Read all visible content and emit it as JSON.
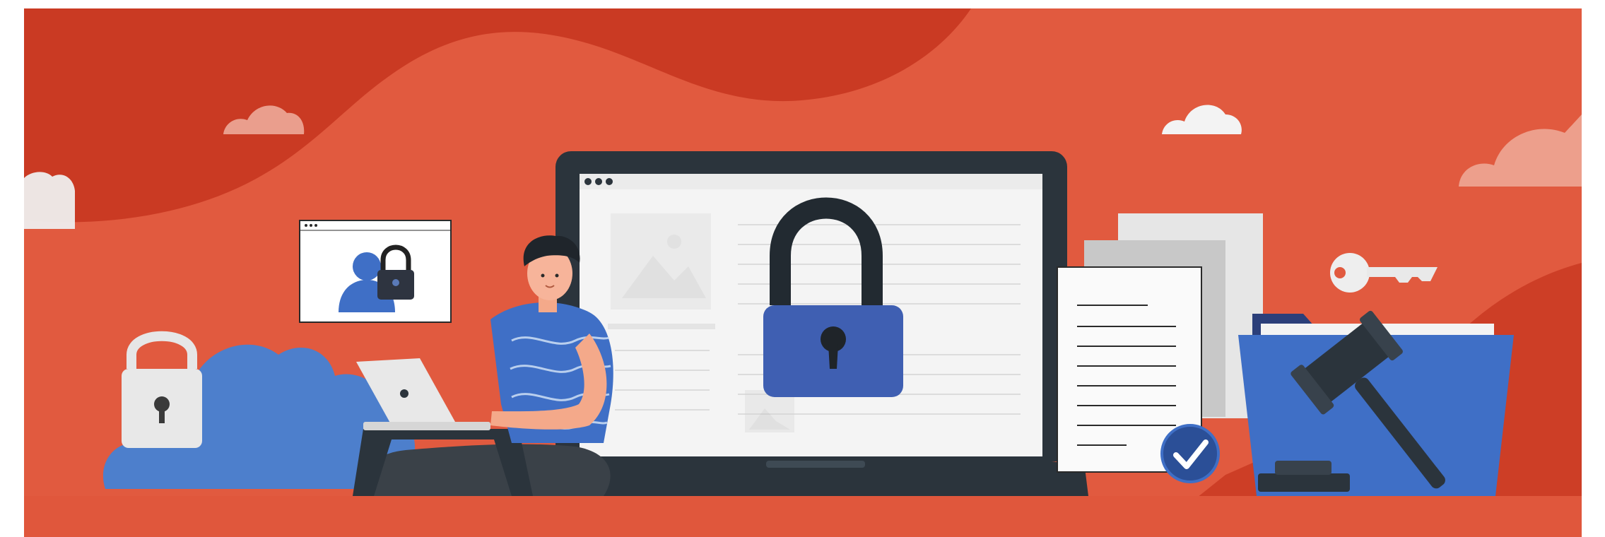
{
  "scene": {
    "name": "data-privacy-security-illustration",
    "elements": [
      "cloud-icon",
      "lock-icon",
      "profile-lock-window",
      "person-with-laptop",
      "laptop-screen-lock",
      "document-stack",
      "checkmark-badge-icon",
      "key-icon",
      "folder-icon",
      "gavel-icon"
    ]
  },
  "colors": {
    "background": "#e15a3f",
    "background_dark": "#c6351f",
    "blue": "#3f6fc6",
    "blue_dark": "#2b4f97",
    "navy": "#2b3f7a",
    "dark": "#29323a",
    "screen": "#f4f4f4",
    "cloud": "#eeeeee",
    "paper": "#f9f9f9"
  }
}
